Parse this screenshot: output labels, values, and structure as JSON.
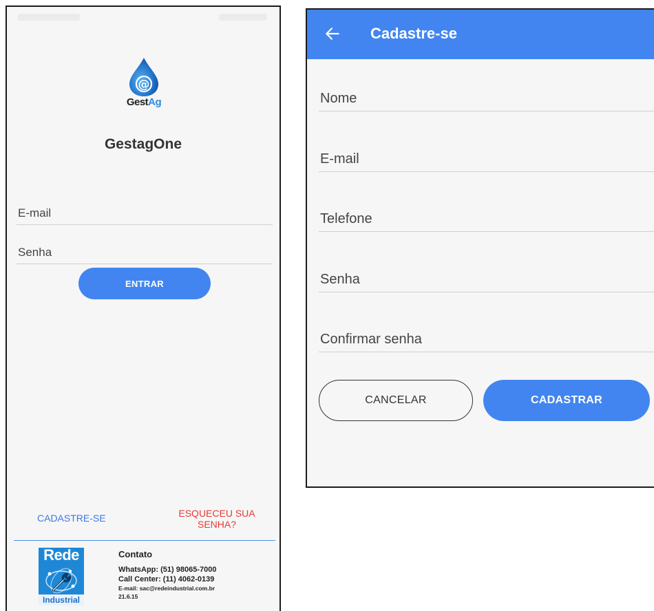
{
  "login": {
    "logo": {
      "text_gest": "Gest",
      "text_ag": "Ag"
    },
    "app_title": "GestagOne",
    "email_placeholder": "E-mail",
    "password_placeholder": "Senha",
    "enter_button": "ENTRAR",
    "register_link": "CADASTRE-SE",
    "forgot_link_line1": "ESQUECEU SUA",
    "forgot_link_line2": "SENHA?",
    "footer": {
      "rede_logo_top": "Rede",
      "rede_logo_bottom": "Industrial",
      "contact_title": "Contato",
      "whatsapp": "WhatsApp: (51) 98065-7000",
      "call_center": "Call Center: (11) 4062-0139",
      "email": "E-mail: sac@redeindustrial.com.br",
      "version": "21.6.15"
    }
  },
  "register": {
    "title": "Cadastre-se",
    "fields": {
      "nome": "Nome",
      "email": "E-mail",
      "telefone": "Telefone",
      "senha": "Senha",
      "confirmar": "Confirmar senha"
    },
    "cancel_button": "CANCELAR",
    "submit_button": "CADASTRAR"
  },
  "colors": {
    "primary": "#4285f0",
    "link_blue": "#3b78e7",
    "link_red": "#e53935",
    "background": "#f6f6f6"
  },
  "icons": {
    "back": "arrow-left-icon",
    "logo": "water-drop-at-icon"
  }
}
